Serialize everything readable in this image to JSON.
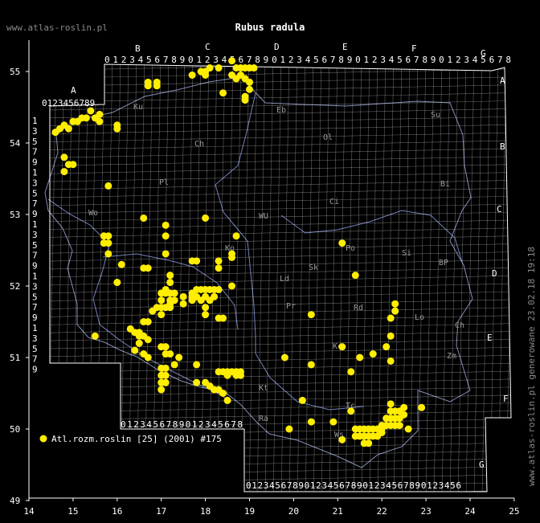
{
  "title": "Rubus radula",
  "watermark_left": "www.atlas-roslin.pl",
  "watermark_right": "www.atlas-roslin.pl generowane 23.02.18 19:18",
  "legend": {
    "label": "Atl.rozm.roslin [25] (2001) #175",
    "color": "#ffee00"
  },
  "x_ticks": [
    "14",
    "15",
    "16",
    "17",
    "18",
    "19",
    "20",
    "21",
    "22",
    "23",
    "24",
    "25"
  ],
  "y_ticks": [
    "55",
    "54",
    "53",
    "52",
    "51",
    "50",
    "49"
  ],
  "grid_letters_top": [
    "A",
    "B",
    "C",
    "D",
    "E",
    "F",
    "G"
  ],
  "grid_letters_right": [
    "A",
    "B",
    "C",
    "D",
    "E",
    "F",
    "G"
  ],
  "grid_digits_top_a": "0123456789",
  "grid_digits_top_b": "0123456789012345678901234567890123456789012345678",
  "grid_digits_bottom_b": "0123456789012345678",
  "grid_digits_bottom_c": "0123456789012345678901234567890123456",
  "grid_digits_left": [
    "1",
    "3",
    "5",
    "7",
    "9",
    "1",
    "3",
    "5",
    "7",
    "9",
    "1",
    "3",
    "5",
    "7",
    "9",
    "1",
    "3",
    "5",
    "7",
    "9",
    "1",
    "3",
    "5",
    "7",
    "9"
  ],
  "region_codes": [
    "Ku",
    "Eb",
    "Su",
    "Ol",
    "Ch",
    "Pl",
    "Bi",
    "Ci",
    "WU",
    "Ko",
    "Si",
    "BP",
    "Ld",
    "Rd",
    "Lo",
    "Pr",
    "Ch",
    "Kc",
    "Zm",
    "Kt",
    "Tc",
    "Wo",
    "Ws",
    "Po",
    "Ra",
    "Sk"
  ],
  "points": [
    [
      14.6,
      54.15
    ],
    [
      14.7,
      54.2
    ],
    [
      14.8,
      54.25
    ],
    [
      14.9,
      54.2
    ],
    [
      15.0,
      54.3
    ],
    [
      15.1,
      54.3
    ],
    [
      15.2,
      54.35
    ],
    [
      15.3,
      54.35
    ],
    [
      15.4,
      54.45
    ],
    [
      15.5,
      54.35
    ],
    [
      15.6,
      54.4
    ],
    [
      15.6,
      54.3
    ],
    [
      14.8,
      53.8
    ],
    [
      14.9,
      53.7
    ],
    [
      15.0,
      53.7
    ],
    [
      14.8,
      53.6
    ],
    [
      15.8,
      53.4
    ],
    [
      16.0,
      54.25
    ],
    [
      16.0,
      54.2
    ],
    [
      16.7,
      54.85
    ],
    [
      16.9,
      54.85
    ],
    [
      16.7,
      54.8
    ],
    [
      16.9,
      54.8
    ],
    [
      17.7,
      54.95
    ],
    [
      17.9,
      55.0
    ],
    [
      18.0,
      55.0
    ],
    [
      18.0,
      54.95
    ],
    [
      18.1,
      55.05
    ],
    [
      18.3,
      55.05
    ],
    [
      18.6,
      55.15
    ],
    [
      18.7,
      55.05
    ],
    [
      18.8,
      55.05
    ],
    [
      18.9,
      55.05
    ],
    [
      19.0,
      55.05
    ],
    [
      19.1,
      55.05
    ],
    [
      18.6,
      54.95
    ],
    [
      18.8,
      54.95
    ],
    [
      18.7,
      54.9
    ],
    [
      18.9,
      54.9
    ],
    [
      19.0,
      54.85
    ],
    [
      19.0,
      54.75
    ],
    [
      18.9,
      54.65
    ],
    [
      18.4,
      54.7
    ],
    [
      18.9,
      54.6
    ],
    [
      18.0,
      52.95
    ],
    [
      16.6,
      52.95
    ],
    [
      17.1,
      52.85
    ],
    [
      17.1,
      52.7
    ],
    [
      15.7,
      52.7
    ],
    [
      15.8,
      52.7
    ],
    [
      15.7,
      52.6
    ],
    [
      15.8,
      52.6
    ],
    [
      15.8,
      52.45
    ],
    [
      16.1,
      52.3
    ],
    [
      16.6,
      52.25
    ],
    [
      16.7,
      52.25
    ],
    [
      17.1,
      52.45
    ],
    [
      17.7,
      52.35
    ],
    [
      17.8,
      52.35
    ],
    [
      18.3,
      52.35
    ],
    [
      18.3,
      52.25
    ],
    [
      18.6,
      52.45
    ],
    [
      18.6,
      52.4
    ],
    [
      18.7,
      52.7
    ],
    [
      18.6,
      52.0
    ],
    [
      16.0,
      52.05
    ],
    [
      17.2,
      52.15
    ],
    [
      17.2,
      52.05
    ],
    [
      17.1,
      51.95
    ],
    [
      17.0,
      51.9
    ],
    [
      17.1,
      51.9
    ],
    [
      17.2,
      51.9
    ],
    [
      17.3,
      51.9
    ],
    [
      17.0,
      51.8
    ],
    [
      17.2,
      51.8
    ],
    [
      16.9,
      51.7
    ],
    [
      17.0,
      51.7
    ],
    [
      17.1,
      51.7
    ],
    [
      17.2,
      51.7
    ],
    [
      16.8,
      51.65
    ],
    [
      17.0,
      51.6
    ],
    [
      17.3,
      51.8
    ],
    [
      17.5,
      51.85
    ],
    [
      17.7,
      51.9
    ],
    [
      17.8,
      51.95
    ],
    [
      17.9,
      51.95
    ],
    [
      18.0,
      51.95
    ],
    [
      18.1,
      51.95
    ],
    [
      18.2,
      51.95
    ],
    [
      18.3,
      51.95
    ],
    [
      17.7,
      51.85
    ],
    [
      17.8,
      51.85
    ],
    [
      18.0,
      51.85
    ],
    [
      18.2,
      51.85
    ],
    [
      17.7,
      51.8
    ],
    [
      17.9,
      51.8
    ],
    [
      18.1,
      51.8
    ],
    [
      18.0,
      51.7
    ],
    [
      17.2,
      51.75
    ],
    [
      17.5,
      51.75
    ],
    [
      18.0,
      51.6
    ],
    [
      18.3,
      51.55
    ],
    [
      18.4,
      51.55
    ],
    [
      16.6,
      51.5
    ],
    [
      16.7,
      51.5
    ],
    [
      16.3,
      51.4
    ],
    [
      16.4,
      51.35
    ],
    [
      16.5,
      51.35
    ],
    [
      16.5,
      51.3
    ],
    [
      16.6,
      51.3
    ],
    [
      16.7,
      51.25
    ],
    [
      16.5,
      51.2
    ],
    [
      16.4,
      51.1
    ],
    [
      16.6,
      51.05
    ],
    [
      17.0,
      51.15
    ],
    [
      17.1,
      51.15
    ],
    [
      17.1,
      51.05
    ],
    [
      17.2,
      51.05
    ],
    [
      15.5,
      51.3
    ],
    [
      16.7,
      51.0
    ],
    [
      17.4,
      51.0
    ],
    [
      17.3,
      50.9
    ],
    [
      17.0,
      50.85
    ],
    [
      17.1,
      50.85
    ],
    [
      17.0,
      50.75
    ],
    [
      17.1,
      50.75
    ],
    [
      17.0,
      50.65
    ],
    [
      17.1,
      50.65
    ],
    [
      17.0,
      50.55
    ],
    [
      17.8,
      50.9
    ],
    [
      18.3,
      50.8
    ],
    [
      18.4,
      50.8
    ],
    [
      18.5,
      50.8
    ],
    [
      18.6,
      50.8
    ],
    [
      18.7,
      50.8
    ],
    [
      18.8,
      50.8
    ],
    [
      18.5,
      50.75
    ],
    [
      18.7,
      50.75
    ],
    [
      18.8,
      50.75
    ],
    [
      17.8,
      50.65
    ],
    [
      18.0,
      50.65
    ],
    [
      18.1,
      50.6
    ],
    [
      18.2,
      50.55
    ],
    [
      18.3,
      50.55
    ],
    [
      18.4,
      50.5
    ],
    [
      18.5,
      50.4
    ],
    [
      21.1,
      52.6
    ],
    [
      21.4,
      52.15
    ],
    [
      22.3,
      51.75
    ],
    [
      22.3,
      51.65
    ],
    [
      22.2,
      51.55
    ],
    [
      22.2,
      51.3
    ],
    [
      20.4,
      51.6
    ],
    [
      21.1,
      51.15
    ],
    [
      21.5,
      51.0
    ],
    [
      21.8,
      51.05
    ],
    [
      22.1,
      51.15
    ],
    [
      22.2,
      50.95
    ],
    [
      19.8,
      51.0
    ],
    [
      20.4,
      50.9
    ],
    [
      21.3,
      50.8
    ],
    [
      20.2,
      50.4
    ],
    [
      20.4,
      50.1
    ],
    [
      20.9,
      50.1
    ],
    [
      21.3,
      50.25
    ],
    [
      21.1,
      49.85
    ],
    [
      19.9,
      50.0
    ],
    [
      21.4,
      50.0
    ],
    [
      21.5,
      50.0
    ],
    [
      21.6,
      50.0
    ],
    [
      21.7,
      50.0
    ],
    [
      21.8,
      50.0
    ],
    [
      21.9,
      50.0
    ],
    [
      22.0,
      50.0
    ],
    [
      21.4,
      49.9
    ],
    [
      21.5,
      49.9
    ],
    [
      21.6,
      49.9
    ],
    [
      21.7,
      49.9
    ],
    [
      21.8,
      49.9
    ],
    [
      21.9,
      49.9
    ],
    [
      21.6,
      49.8
    ],
    [
      21.7,
      49.8
    ],
    [
      22.1,
      50.05
    ],
    [
      22.2,
      50.05
    ],
    [
      22.3,
      50.05
    ],
    [
      22.4,
      50.05
    ],
    [
      22.1,
      50.15
    ],
    [
      22.2,
      50.15
    ],
    [
      22.3,
      50.15
    ],
    [
      22.4,
      50.15
    ],
    [
      22.2,
      50.25
    ],
    [
      22.3,
      50.25
    ],
    [
      22.4,
      50.25
    ],
    [
      22.2,
      50.35
    ],
    [
      22.5,
      50.3
    ],
    [
      22.9,
      50.3
    ],
    [
      22.5,
      50.2
    ],
    [
      22.6,
      50.0
    ],
    [
      22.0,
      50.05
    ],
    [
      22.0,
      49.95
    ]
  ]
}
